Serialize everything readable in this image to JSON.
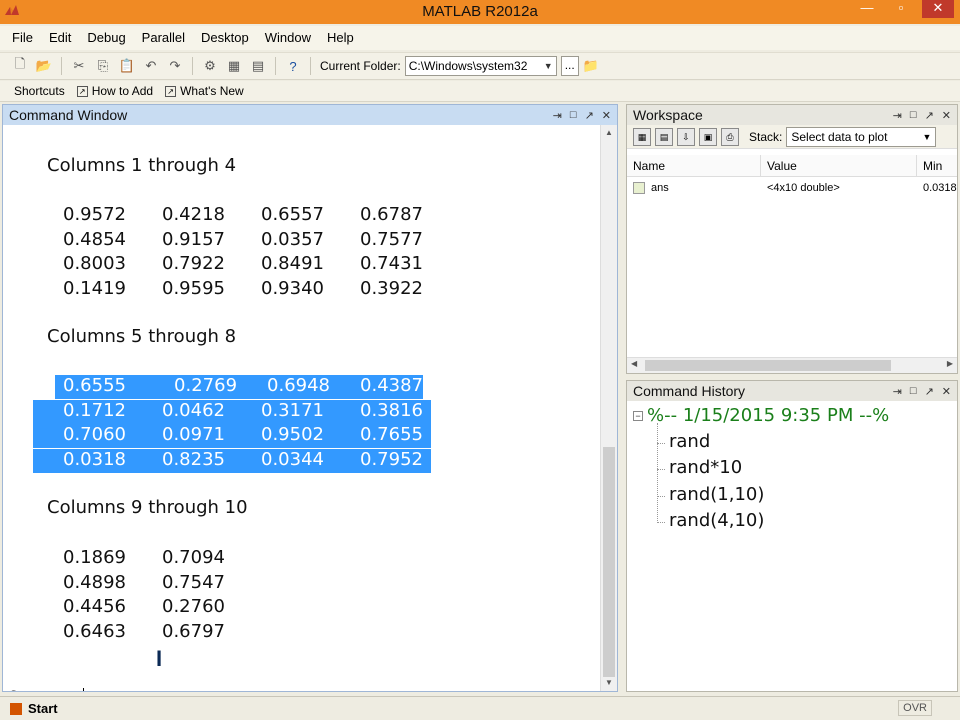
{
  "window": {
    "title": "MATLAB  R2012a"
  },
  "menu": [
    "File",
    "Edit",
    "Debug",
    "Parallel",
    "Desktop",
    "Window",
    "Help"
  ],
  "toolbar": {
    "current_folder_label": "Current Folder:",
    "current_folder_value": "C:\\Windows\\system32",
    "browse_label": "..."
  },
  "shortcuts": [
    "Shortcuts",
    "How to Add",
    "What's New"
  ],
  "command_window": {
    "title": "Command Window",
    "headers": [
      "Columns 1 through 4",
      "Columns 5 through 8",
      "Columns 9 through 10"
    ],
    "block1": [
      [
        "0.9572",
        "0.4218",
        "0.6557",
        "0.6787"
      ],
      [
        "0.4854",
        "0.9157",
        "0.0357",
        "0.7577"
      ],
      [
        "0.8003",
        "0.7922",
        "0.8491",
        "0.7431"
      ],
      [
        "0.1419",
        "0.9595",
        "0.9340",
        "0.3922"
      ]
    ],
    "block2": [
      [
        "0.6555",
        "0.2769",
        "0.6948",
        "0.4387"
      ],
      [
        "0.1712",
        "0.0462",
        "0.3171",
        "0.3816"
      ],
      [
        "0.7060",
        "0.0971",
        "0.9502",
        "0.7655"
      ],
      [
        "0.0318",
        "0.8235",
        "0.0344",
        "0.7952"
      ]
    ],
    "block3": [
      [
        "0.1869",
        "0.7094"
      ],
      [
        "0.4898",
        "0.7547"
      ],
      [
        "0.4456",
        "0.2760"
      ],
      [
        "0.6463",
        "0.6797"
      ]
    ],
    "prompt_fx": "fx",
    "prompt": ">>"
  },
  "workspace": {
    "title": "Workspace",
    "stack_label": "Stack:",
    "plot_selector": "Select data to plot",
    "columns": [
      "Name",
      "Value",
      "Min"
    ],
    "rows": [
      {
        "name": "ans",
        "value": "<4x10 double>",
        "min": "0.0318"
      }
    ]
  },
  "command_history": {
    "title": "Command History",
    "session": "%-- 1/15/2015 9:35 PM --%",
    "commands": [
      "rand",
      "rand*10",
      "rand(1,10)",
      "rand(4,10)"
    ]
  },
  "statusbar": {
    "start_label": "Start",
    "mode": "OVR"
  },
  "colors": {
    "titlebar": "#f08a24",
    "selection": "#3399ff",
    "history_session": "#1a7f1a"
  }
}
